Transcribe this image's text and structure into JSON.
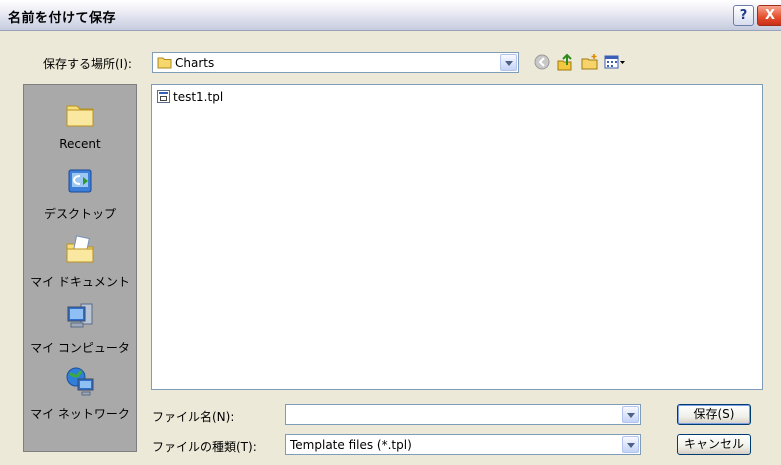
{
  "window": {
    "title": "名前を付けて保存"
  },
  "title_buttons": {
    "help": "?",
    "close": "X"
  },
  "save_in": {
    "label": "保存する場所(I):",
    "value": "Charts"
  },
  "toolbar_icons": [
    "back-icon",
    "up-folder-icon",
    "new-folder-icon",
    "view-menu-icon"
  ],
  "places": [
    {
      "label": "Recent",
      "icon": "recent-folder-icon"
    },
    {
      "label": "デスクトップ",
      "icon": "desktop-icon"
    },
    {
      "label": "マイ ドキュメント",
      "icon": "my-documents-icon"
    },
    {
      "label": "マイ コンピュータ",
      "icon": "my-computer-icon"
    },
    {
      "label": "マイ ネットワーク",
      "icon": "my-network-icon"
    }
  ],
  "files": [
    {
      "name": "test1.tpl",
      "icon": "tpl-file-icon"
    }
  ],
  "filename": {
    "label": "ファイル名(N):",
    "value": ""
  },
  "filetype": {
    "label": "ファイルの種類(T):",
    "value": "Template files (*.tpl)"
  },
  "buttons": {
    "save": "保存(S)",
    "cancel": "キャンセル"
  }
}
